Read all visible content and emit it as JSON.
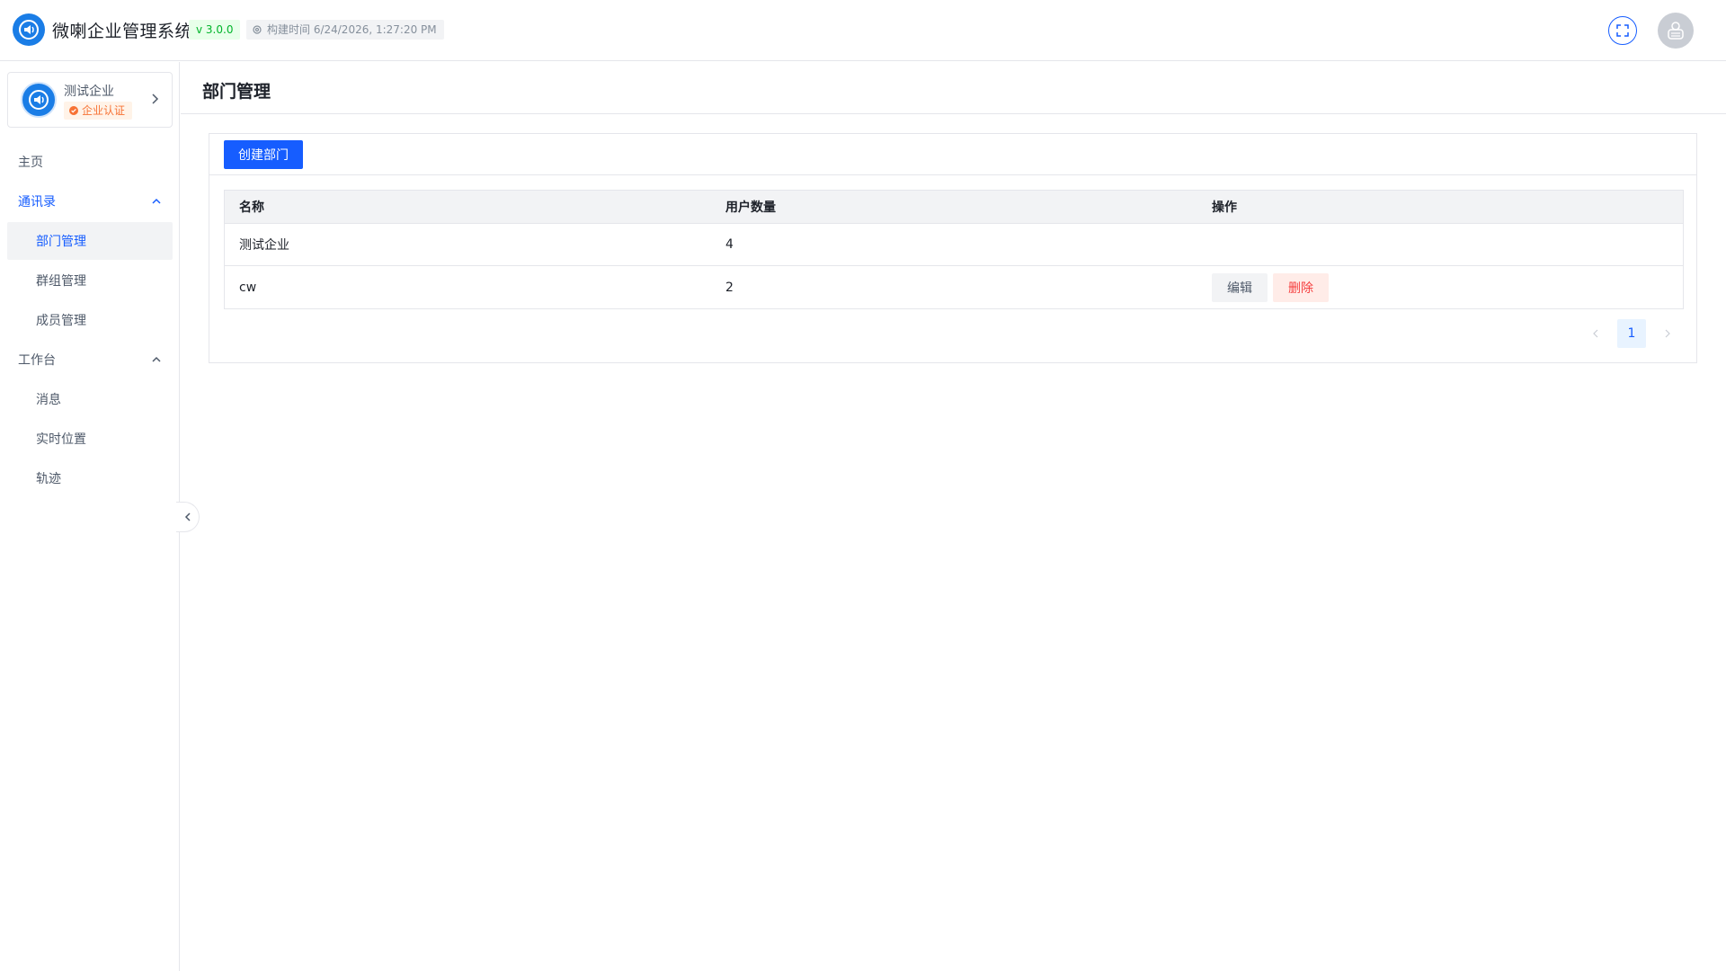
{
  "header": {
    "app_title": "微喇企业管理系统",
    "version": "v 3.0.0",
    "build_time": "构建时间 6/24/2026, 1:27:20 PM"
  },
  "sidebar": {
    "org": {
      "name": "测试企业",
      "badge": "企业认证"
    },
    "menu": [
      {
        "label": "主页"
      },
      {
        "label": "通讯录",
        "expanded": true
      },
      {
        "label": "部门管理",
        "selected": true
      },
      {
        "label": "群组管理"
      },
      {
        "label": "成员管理"
      },
      {
        "label": "工作台",
        "expanded": true
      },
      {
        "label": "消息"
      },
      {
        "label": "实时位置"
      },
      {
        "label": "轨迹"
      }
    ]
  },
  "page": {
    "title": "部门管理",
    "create_button": "创建部门",
    "table": {
      "headers": [
        "名称",
        "用户数量",
        "操作"
      ],
      "rows": [
        {
          "name": "测试企业",
          "users": "4"
        },
        {
          "name": "cw",
          "users": "2",
          "edit": "编辑",
          "delete": "删除"
        }
      ]
    },
    "pagination": {
      "current": "1"
    }
  },
  "colors": {
    "primary": "#165dff",
    "success": "#00b42a",
    "warning": "#f77234",
    "danger": "#f53f3f",
    "logo": "#1a7de6"
  }
}
